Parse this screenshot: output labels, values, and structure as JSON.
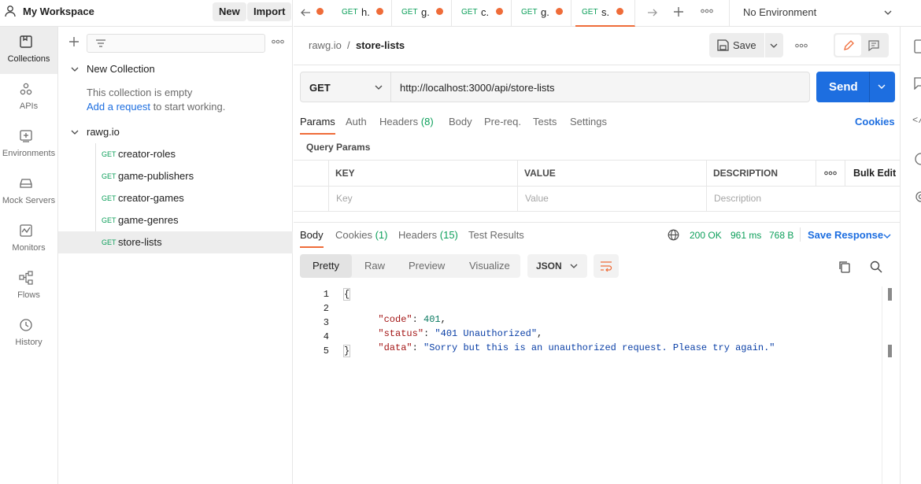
{
  "workspace": {
    "name": "My Workspace",
    "new_label": "New",
    "import_label": "Import"
  },
  "rail": [
    {
      "label": "Collections",
      "icon": "collections-icon"
    },
    {
      "label": "APIs",
      "icon": "apis-icon"
    },
    {
      "label": "Environments",
      "icon": "environments-icon"
    },
    {
      "label": "Mock Servers",
      "icon": "mock-servers-icon"
    },
    {
      "label": "Monitors",
      "icon": "monitors-icon"
    },
    {
      "label": "Flows",
      "icon": "flows-icon"
    },
    {
      "label": "History",
      "icon": "history-icon"
    }
  ],
  "sidebar": {
    "search_placeholder": "",
    "new_collection": {
      "name": "New Collection",
      "empty_text": "This collection is empty",
      "add_link": "Add a request",
      "add_suffix": " to start working."
    },
    "collection": {
      "name": "rawg.io",
      "requests": [
        {
          "method": "GET",
          "name": "creator-roles"
        },
        {
          "method": "GET",
          "name": "game-publishers"
        },
        {
          "method": "GET",
          "name": "creator-games"
        },
        {
          "method": "GET",
          "name": "game-genres"
        },
        {
          "method": "GET",
          "name": "store-lists"
        }
      ]
    }
  },
  "tabs": {
    "items": [
      {
        "method": "GET",
        "name": "h."
      },
      {
        "method": "GET",
        "name": "g."
      },
      {
        "method": "GET",
        "name": "c."
      },
      {
        "method": "GET",
        "name": "g."
      },
      {
        "method": "GET",
        "name": "s."
      }
    ],
    "environment": "No Environment"
  },
  "request": {
    "breadcrumb_parent": "rawg.io",
    "breadcrumb_sep": "/",
    "title": "store-lists",
    "save_label": "Save",
    "method": "GET",
    "url": "http://localhost:3000/api/store-lists",
    "send_label": "Send",
    "subtabs": [
      "Params",
      "Auth",
      "Headers",
      "Body",
      "Pre-req.",
      "Tests",
      "Settings"
    ],
    "headers_count": "(8)",
    "cookies_label": "Cookies",
    "query_params_label": "Query Params",
    "table": {
      "headers": [
        "KEY",
        "VALUE",
        "DESCRIPTION"
      ],
      "bulk_edit": "Bulk Edit",
      "placeholders": [
        "Key",
        "Value",
        "Description"
      ]
    }
  },
  "response": {
    "tabs": [
      "Body",
      "Cookies",
      "Headers",
      "Test Results"
    ],
    "cookies_count": "(1)",
    "headers_count": "(15)",
    "status": "200 OK",
    "time": "961 ms",
    "size": "768 B",
    "save_label": "Save Response",
    "views": [
      "Pretty",
      "Raw",
      "Preview",
      "Visualize"
    ],
    "format": "JSON",
    "lines": [
      {
        "n": "1",
        "text": "{"
      },
      {
        "n": "2",
        "key": "\"code\"",
        "val": "401",
        "comma": ","
      },
      {
        "n": "3",
        "key": "\"status\"",
        "val": "\"401 Unauthorized\"",
        "comma": ","
      },
      {
        "n": "4",
        "key": "\"data\"",
        "val": "\"Sorry but this is an unauthorized request. Please try again.\"",
        "comma": ""
      },
      {
        "n": "5",
        "text": "}"
      }
    ]
  },
  "colors": {
    "accent": "#ef6c39",
    "primary": "#1d6ee0",
    "ok": "#0c9f5a"
  }
}
